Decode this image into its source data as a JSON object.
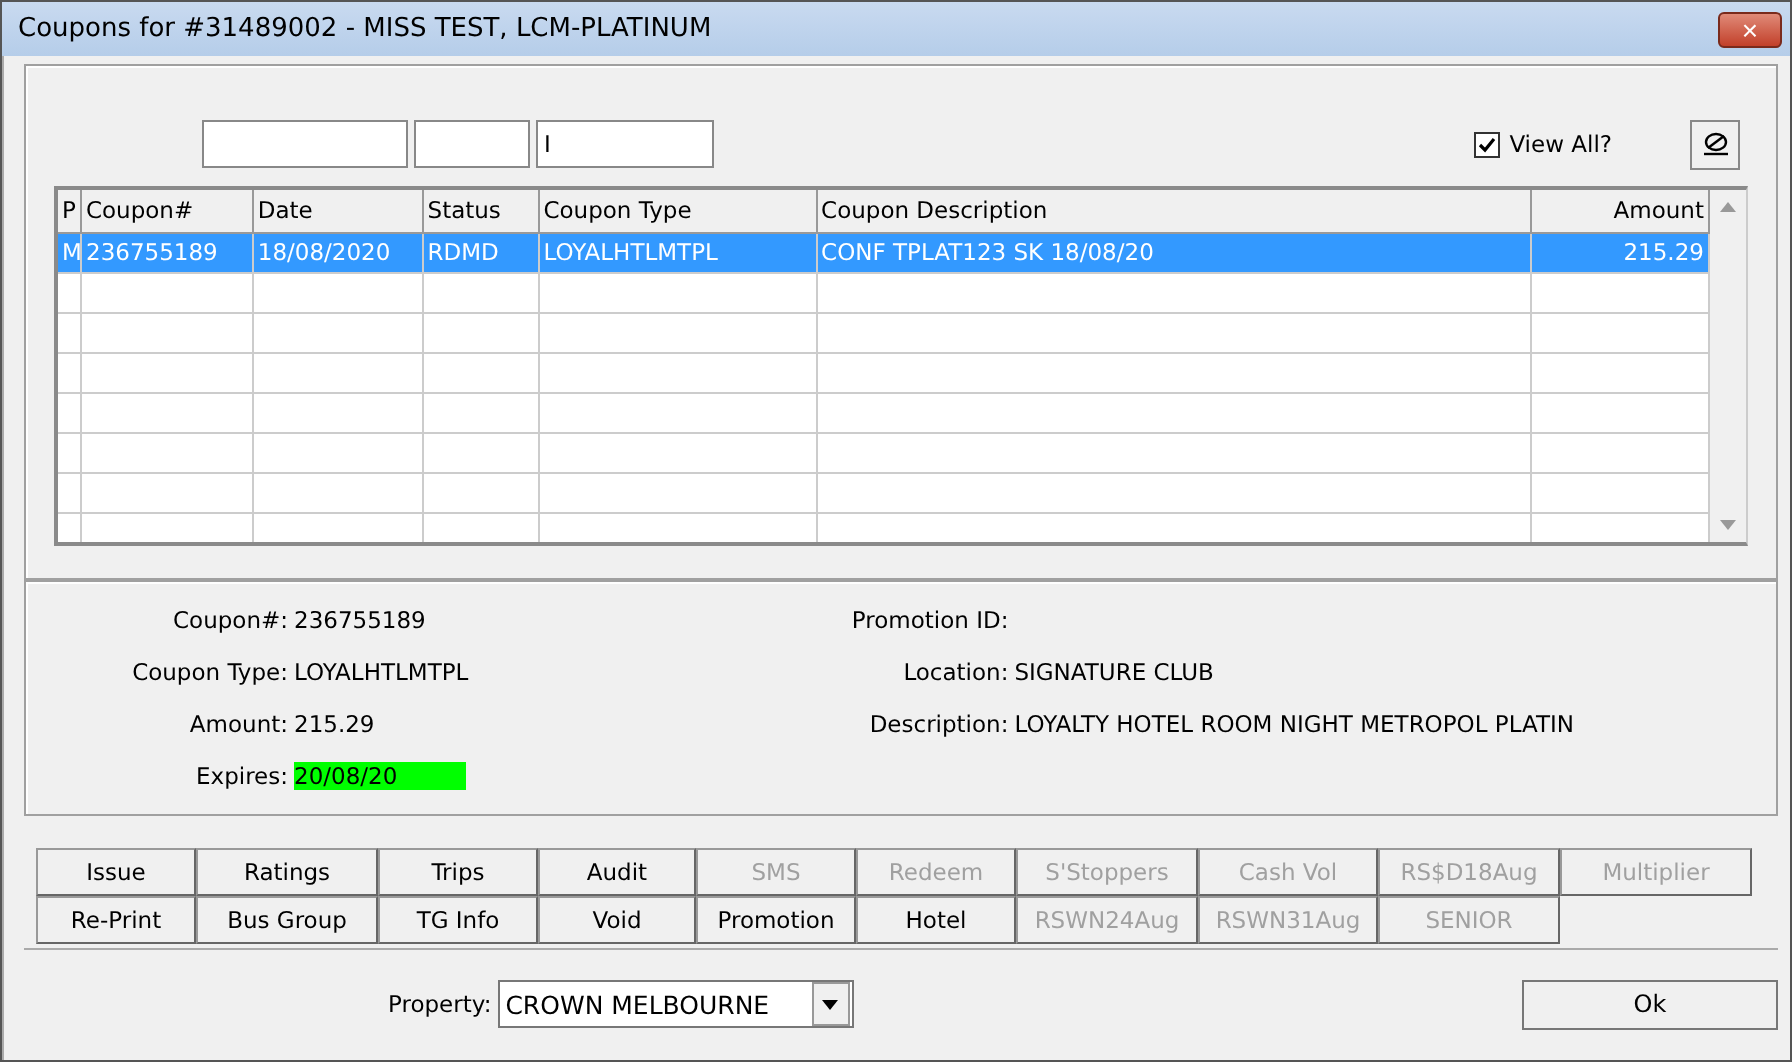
{
  "window": {
    "title": "Coupons for #31489002 - MISS TEST, LCM-PLATINUM",
    "close": "×"
  },
  "filter": {
    "value": "I"
  },
  "view_all": {
    "label": "View All?",
    "checked": true
  },
  "table": {
    "columns": [
      "P",
      "Coupon#",
      "Date",
      "Status",
      "Coupon Type",
      "Coupon Description",
      "Amount"
    ],
    "rows": [
      {
        "selected": true,
        "cells": [
          "M",
          "236755189",
          "18/08/2020",
          "RDMD",
          "LOYALHTLMTPL",
          "CONF TPLAT123 SK 18/08/20",
          "215.29"
        ]
      }
    ]
  },
  "details_left": [
    {
      "label": "Coupon#:",
      "value": "236755189",
      "highlight": false
    },
    {
      "label": "Coupon Type:",
      "value": "LOYALHTLMTPL",
      "highlight": false
    },
    {
      "label": "Amount:",
      "value": "215.29",
      "highlight": false
    },
    {
      "label": "Expires:",
      "value": "20/08/20",
      "highlight": true
    }
  ],
  "details_right": [
    {
      "label": "Promotion ID:"
    },
    {
      "label": "Location:",
      "value": "SIGNATURE CLUB"
    },
    {
      "label": "Description:",
      "value": "LOYALTY HOTEL ROOM NIGHT METROPOL PLATIN"
    }
  ],
  "buttons": [
    [
      {
        "label": "Issue",
        "disabled": false
      },
      {
        "label": "Ratings",
        "disabled": false
      },
      {
        "label": "Trips",
        "disabled": false
      },
      {
        "label": "Audit",
        "disabled": false
      },
      {
        "label": "SMS",
        "disabled": true
      },
      {
        "label": "Redeem",
        "disabled": true
      },
      {
        "label": "S'Stoppers",
        "disabled": true
      },
      {
        "label": "Cash Vol",
        "disabled": true
      },
      {
        "label": "RS$D18Aug",
        "disabled": true
      },
      {
        "label": "Multiplier",
        "disabled": true
      }
    ],
    [
      {
        "label": "Re-Print",
        "disabled": false
      },
      {
        "label": "Bus Group",
        "disabled": false
      },
      {
        "label": "TG Info",
        "disabled": false
      },
      {
        "label": "Void",
        "disabled": false
      },
      {
        "label": "Promotion",
        "disabled": false
      },
      {
        "label": "Hotel",
        "disabled": false
      },
      {
        "label": "RSWN24Aug",
        "disabled": true
      },
      {
        "label": "RSWN31Aug",
        "disabled": true
      },
      {
        "label": "SENIOR",
        "disabled": true
      }
    ]
  ],
  "property": {
    "label": "Property:",
    "value": "CROWN MELBOURNE"
  },
  "ok_button": "Ok"
}
